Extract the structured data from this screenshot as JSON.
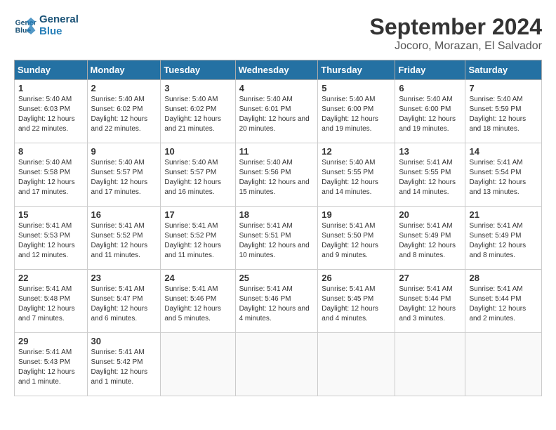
{
  "logo": {
    "line1": "General",
    "line2": "Blue"
  },
  "title": "September 2024",
  "subtitle": "Jocoro, Morazan, El Salvador",
  "days_of_week": [
    "Sunday",
    "Monday",
    "Tuesday",
    "Wednesday",
    "Thursday",
    "Friday",
    "Saturday"
  ],
  "weeks": [
    [
      {
        "num": "1",
        "sunrise": "5:40 AM",
        "sunset": "6:03 PM",
        "daylight": "12 hours and 22 minutes."
      },
      {
        "num": "2",
        "sunrise": "5:40 AM",
        "sunset": "6:02 PM",
        "daylight": "12 hours and 22 minutes."
      },
      {
        "num": "3",
        "sunrise": "5:40 AM",
        "sunset": "6:02 PM",
        "daylight": "12 hours and 21 minutes."
      },
      {
        "num": "4",
        "sunrise": "5:40 AM",
        "sunset": "6:01 PM",
        "daylight": "12 hours and 20 minutes."
      },
      {
        "num": "5",
        "sunrise": "5:40 AM",
        "sunset": "6:00 PM",
        "daylight": "12 hours and 19 minutes."
      },
      {
        "num": "6",
        "sunrise": "5:40 AM",
        "sunset": "6:00 PM",
        "daylight": "12 hours and 19 minutes."
      },
      {
        "num": "7",
        "sunrise": "5:40 AM",
        "sunset": "5:59 PM",
        "daylight": "12 hours and 18 minutes."
      }
    ],
    [
      {
        "num": "8",
        "sunrise": "5:40 AM",
        "sunset": "5:58 PM",
        "daylight": "12 hours and 17 minutes."
      },
      {
        "num": "9",
        "sunrise": "5:40 AM",
        "sunset": "5:57 PM",
        "daylight": "12 hours and 17 minutes."
      },
      {
        "num": "10",
        "sunrise": "5:40 AM",
        "sunset": "5:57 PM",
        "daylight": "12 hours and 16 minutes."
      },
      {
        "num": "11",
        "sunrise": "5:40 AM",
        "sunset": "5:56 PM",
        "daylight": "12 hours and 15 minutes."
      },
      {
        "num": "12",
        "sunrise": "5:40 AM",
        "sunset": "5:55 PM",
        "daylight": "12 hours and 14 minutes."
      },
      {
        "num": "13",
        "sunrise": "5:41 AM",
        "sunset": "5:55 PM",
        "daylight": "12 hours and 14 minutes."
      },
      {
        "num": "14",
        "sunrise": "5:41 AM",
        "sunset": "5:54 PM",
        "daylight": "12 hours and 13 minutes."
      }
    ],
    [
      {
        "num": "15",
        "sunrise": "5:41 AM",
        "sunset": "5:53 PM",
        "daylight": "12 hours and 12 minutes."
      },
      {
        "num": "16",
        "sunrise": "5:41 AM",
        "sunset": "5:52 PM",
        "daylight": "12 hours and 11 minutes."
      },
      {
        "num": "17",
        "sunrise": "5:41 AM",
        "sunset": "5:52 PM",
        "daylight": "12 hours and 11 minutes."
      },
      {
        "num": "18",
        "sunrise": "5:41 AM",
        "sunset": "5:51 PM",
        "daylight": "12 hours and 10 minutes."
      },
      {
        "num": "19",
        "sunrise": "5:41 AM",
        "sunset": "5:50 PM",
        "daylight": "12 hours and 9 minutes."
      },
      {
        "num": "20",
        "sunrise": "5:41 AM",
        "sunset": "5:49 PM",
        "daylight": "12 hours and 8 minutes."
      },
      {
        "num": "21",
        "sunrise": "5:41 AM",
        "sunset": "5:49 PM",
        "daylight": "12 hours and 8 minutes."
      }
    ],
    [
      {
        "num": "22",
        "sunrise": "5:41 AM",
        "sunset": "5:48 PM",
        "daylight": "12 hours and 7 minutes."
      },
      {
        "num": "23",
        "sunrise": "5:41 AM",
        "sunset": "5:47 PM",
        "daylight": "12 hours and 6 minutes."
      },
      {
        "num": "24",
        "sunrise": "5:41 AM",
        "sunset": "5:46 PM",
        "daylight": "12 hours and 5 minutes."
      },
      {
        "num": "25",
        "sunrise": "5:41 AM",
        "sunset": "5:46 PM",
        "daylight": "12 hours and 4 minutes."
      },
      {
        "num": "26",
        "sunrise": "5:41 AM",
        "sunset": "5:45 PM",
        "daylight": "12 hours and 4 minutes."
      },
      {
        "num": "27",
        "sunrise": "5:41 AM",
        "sunset": "5:44 PM",
        "daylight": "12 hours and 3 minutes."
      },
      {
        "num": "28",
        "sunrise": "5:41 AM",
        "sunset": "5:44 PM",
        "daylight": "12 hours and 2 minutes."
      }
    ],
    [
      {
        "num": "29",
        "sunrise": "5:41 AM",
        "sunset": "5:43 PM",
        "daylight": "12 hours and 1 minute."
      },
      {
        "num": "30",
        "sunrise": "5:41 AM",
        "sunset": "5:42 PM",
        "daylight": "12 hours and 1 minute."
      },
      null,
      null,
      null,
      null,
      null
    ]
  ]
}
